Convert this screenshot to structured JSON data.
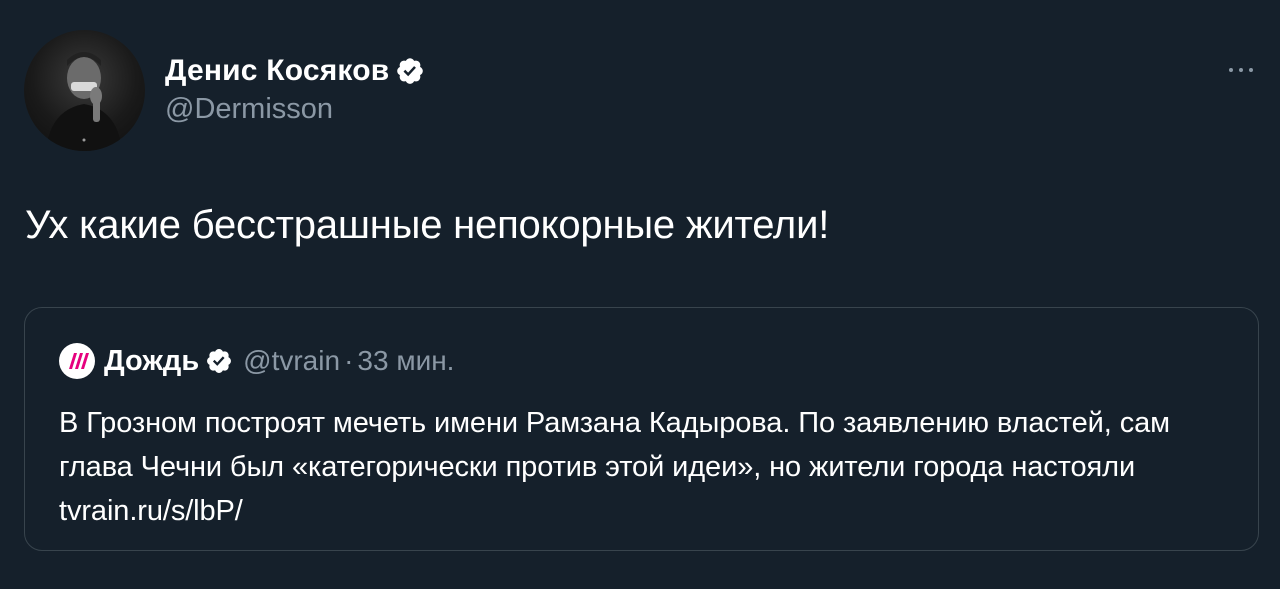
{
  "author": {
    "name": "Денис Косяков",
    "handle": "@Dermisson",
    "verified": true
  },
  "tweet": {
    "text": "Ух какие бесстрашные непокорные жители!"
  },
  "more_icon": "more-horizontal-icon",
  "quoted_tweet": {
    "name": "Дождь",
    "handle": "@tvrain",
    "separator": "·",
    "time": "33 мин.",
    "verified": true,
    "logo_icon": "tvrain-logo-icon",
    "text": "В Грозном построят мечеть имени Рамзана Кадырова. По заявлению властей, сам глава Чечни был «категорически против этой идеи», но жители города настояли tvrain.ru/s/lbP/"
  },
  "colors": {
    "background": "#15202b",
    "primary_text": "#ffffff",
    "secondary_text": "#8b98a5",
    "border": "#38444d",
    "verified_badge": "#ffffff",
    "tvrain_pink": "#e6007e"
  }
}
